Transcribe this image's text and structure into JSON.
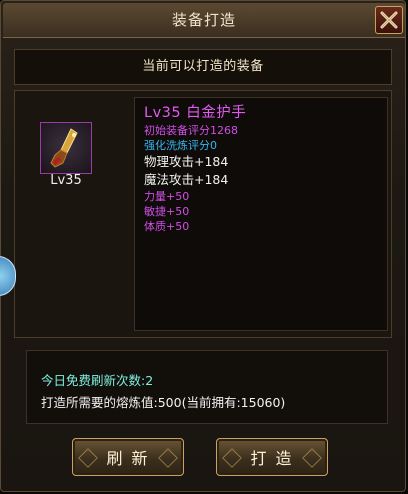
{
  "window": {
    "title": "装备打造"
  },
  "header": {
    "subtitle": "当前可以打造的装备"
  },
  "item": {
    "level_label": "Lv35",
    "name": "Lv35 白金护手",
    "stats": [
      {
        "text": "初始装备评分1268",
        "color": "#d04ee6"
      },
      {
        "text": "强化洗炼评分0",
        "color": "#35b6f0"
      },
      {
        "text": "物理攻击+184",
        "color": "#f2f2f2",
        "big": true
      },
      {
        "text": "魔法攻击+184",
        "color": "#f2f2f2",
        "big": true
      },
      {
        "text": "力量+50",
        "color": "#d04ee6"
      },
      {
        "text": "敏捷+50",
        "color": "#d04ee6"
      },
      {
        "text": "体质+50",
        "color": "#d04ee6"
      }
    ]
  },
  "info": {
    "free_refresh": "今日免费刷新次数:2",
    "cost": "打造所需要的熔炼值:500(当前拥有:15060)"
  },
  "buttons": {
    "refresh": "刷 新",
    "forge": "打 造"
  }
}
